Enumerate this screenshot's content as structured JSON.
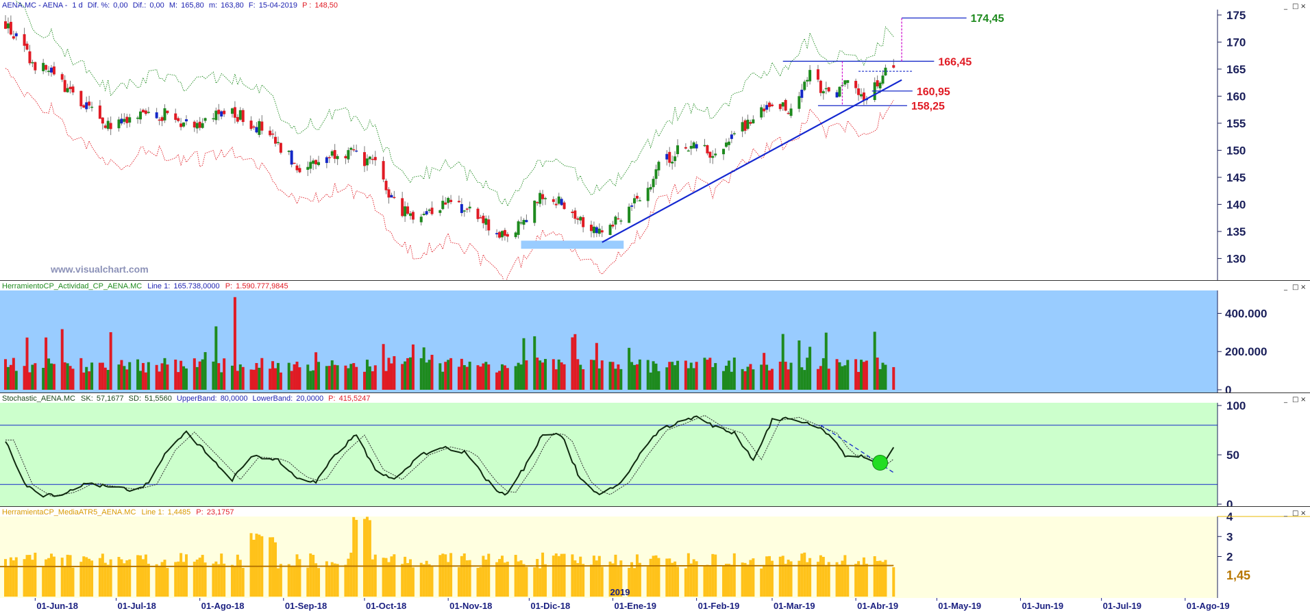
{
  "header": {
    "symbol": "AENA.MC - AENA -",
    "period": "1 d",
    "dif_pct_label": "Dif. %:",
    "dif_pct": "0,00",
    "dif_label": "Dif.:",
    "dif": "0,00",
    "max_label": "M:",
    "max": "165,80",
    "min_label": "m:",
    "min": "163,80",
    "date_label": "F:",
    "date": "15-04-2019",
    "price_label": "P :",
    "price": "148,50"
  },
  "watermark": "www.visualchart.com",
  "colors": {
    "bull": "#1e8a1e",
    "bear": "#e01b24",
    "blue_candle": "#1428c8",
    "upper_band": "#1e8a1e",
    "lower_band": "#e01b24",
    "trendline": "#1428d0",
    "volume_bg": "#99ccff",
    "stoch_bg": "#ccffcc",
    "atr_bg": "#ffffe0",
    "atr_bar": "#ffc21a",
    "atr_avg": "#b87700"
  },
  "window_buttons": [
    "_",
    "□",
    "×"
  ],
  "chart_data": [
    {
      "type": "candlestick",
      "title": "AENA.MC - AENA - 1 d",
      "x_ticks": [
        "01-Jun-18",
        "01-Jul-18",
        "01-Ago-18",
        "01-Sep-18",
        "01-Oct-18",
        "01-Nov-18",
        "01-Dic-18",
        "01-Ene-19",
        "01-Feb-19",
        "01-Mar-19",
        "01-Abr-19",
        "01-May-19",
        "01-Jun-19",
        "01-Jul-19",
        "01-Ago-19"
      ],
      "year_marker": "2019",
      "ylim": [
        126,
        176
      ],
      "y_ticks": [
        130,
        135,
        140,
        145,
        150,
        155,
        160,
        165,
        170,
        175
      ],
      "close_path": [
        [
          "2018-05-21",
          173.5
        ],
        [
          "2018-05-31",
          166
        ],
        [
          "2018-06-08",
          164
        ],
        [
          "2018-06-15",
          160
        ],
        [
          "2018-06-22",
          157
        ],
        [
          "2018-06-29",
          154.5
        ],
        [
          "2018-07-06",
          155
        ],
        [
          "2018-07-13",
          157
        ],
        [
          "2018-07-20",
          156.5
        ],
        [
          "2018-07-27",
          155
        ],
        [
          "2018-08-03",
          155.5
        ],
        [
          "2018-08-10",
          157
        ],
        [
          "2018-08-17",
          156
        ],
        [
          "2018-08-24",
          154
        ],
        [
          "2018-08-31",
          150
        ],
        [
          "2018-09-07",
          147
        ],
        [
          "2018-09-14",
          148
        ],
        [
          "2018-09-21",
          150
        ],
        [
          "2018-09-28",
          149
        ],
        [
          "2018-10-05",
          147
        ],
        [
          "2018-10-12",
          140
        ],
        [
          "2018-10-19",
          138
        ],
        [
          "2018-10-26",
          139
        ],
        [
          "2018-11-02",
          141
        ],
        [
          "2018-11-09",
          138.5
        ],
        [
          "2018-11-16",
          136
        ],
        [
          "2018-11-23",
          133
        ],
        [
          "2018-11-30",
          138
        ],
        [
          "2018-12-07",
          142
        ],
        [
          "2018-12-14",
          140
        ],
        [
          "2018-12-21",
          137
        ],
        [
          "2018-12-28",
          135
        ],
        [
          "2019-01-04",
          138
        ],
        [
          "2019-01-11",
          141
        ],
        [
          "2019-01-18",
          147
        ],
        [
          "2019-01-25",
          150
        ],
        [
          "2019-02-01",
          151
        ],
        [
          "2019-02-08",
          149
        ],
        [
          "2019-02-15",
          153
        ],
        [
          "2019-02-22",
          156
        ],
        [
          "2019-03-01",
          158
        ],
        [
          "2019-03-08",
          158
        ],
        [
          "2019-03-15",
          164
        ],
        [
          "2019-03-22",
          160
        ],
        [
          "2019-03-29",
          162
        ],
        [
          "2019-04-05",
          159.5
        ],
        [
          "2019-04-12",
          164.5
        ],
        [
          "2019-04-15",
          165
        ]
      ],
      "series": [
        {
          "name": "Upper band",
          "offset_above_close": 7
        },
        {
          "name": "Lower band",
          "offset_below_close": 7
        }
      ],
      "trendline": {
        "from": [
          "2018-12-28",
          133
        ],
        "to": [
          "2019-04-18",
          163
        ]
      },
      "support_zone": {
        "from": "2018-11-28",
        "to": "2019-01-05",
        "y_low": 131.8,
        "y_high": 133.3
      },
      "levels": [
        {
          "value": 174.45,
          "label": "174,45",
          "color": "#1e8a1e",
          "from": "2019-04-18",
          "to": "2019-05-12"
        },
        {
          "value": 166.45,
          "label": "166,45",
          "color": "#e01b24",
          "from": "2019-03-05",
          "to": "2019-04-30"
        },
        {
          "value": 160.95,
          "label": "160,95",
          "color": "#e01b24",
          "from": "2019-04-07",
          "to": "2019-04-22"
        },
        {
          "value": 158.25,
          "label": "158,25",
          "color": "#e01b24",
          "from": "2019-03-18",
          "to": "2019-04-20"
        }
      ],
      "target_projection": {
        "x": "2019-04-18",
        "from": 166.45,
        "to": 174.45
      }
    },
    {
      "type": "bar",
      "title": "HerramientoCP_Actividad_CP_AENA.MC",
      "line_label": "Line 1:",
      "line_value": "165.738,0000",
      "p_label": "P:",
      "p_value": "1.590.777,9845",
      "ylim": [
        0,
        520000
      ],
      "y_ticks": [
        {
          "value": 0,
          "label": "0"
        },
        {
          "value": 200000,
          "label": "200.000"
        },
        {
          "value": 400000,
          "label": "400.000"
        }
      ],
      "values_note": "daily volume, green on up days, red on down days"
    },
    {
      "type": "line",
      "title": "Stochastic_AENA.MC",
      "sk_label": "SK:",
      "sk": "57,1677",
      "sd_label": "SD:",
      "sd": "51,5560",
      "upper_label": "UpperBand:",
      "upper": "80,0000",
      "lower_label": "LowerBand:",
      "lower": "20,0000",
      "p_label": "P:",
      "p_value": "415,5247",
      "ylim": [
        0,
        100
      ],
      "y_ticks": [
        {
          "value": 0,
          "label": "0"
        },
        {
          "value": 50,
          "label": "50"
        },
        {
          "value": 100,
          "label": "100"
        }
      ],
      "bands": [
        80,
        20
      ],
      "sk_path": [
        [
          "2018-05-21",
          65
        ],
        [
          "2018-05-28",
          20
        ],
        [
          "2018-06-04",
          8
        ],
        [
          "2018-06-13",
          12
        ],
        [
          "2018-06-20",
          22
        ],
        [
          "2018-06-27",
          18
        ],
        [
          "2018-07-06",
          15
        ],
        [
          "2018-07-13",
          20
        ],
        [
          "2018-07-20",
          55
        ],
        [
          "2018-07-27",
          73
        ],
        [
          "2018-08-06",
          45
        ],
        [
          "2018-08-13",
          25
        ],
        [
          "2018-08-20",
          48
        ],
        [
          "2018-08-30",
          45
        ],
        [
          "2018-09-06",
          28
        ],
        [
          "2018-09-13",
          22
        ],
        [
          "2018-09-20",
          50
        ],
        [
          "2018-09-28",
          70
        ],
        [
          "2018-10-05",
          35
        ],
        [
          "2018-10-12",
          25
        ],
        [
          "2018-10-22",
          50
        ],
        [
          "2018-10-30",
          58
        ],
        [
          "2018-11-08",
          52
        ],
        [
          "2018-11-15",
          25
        ],
        [
          "2018-11-22",
          8
        ],
        [
          "2018-11-30",
          40
        ],
        [
          "2018-12-06",
          72
        ],
        [
          "2018-12-13",
          70
        ],
        [
          "2018-12-20",
          25
        ],
        [
          "2018-12-27",
          8
        ],
        [
          "2019-01-04",
          22
        ],
        [
          "2019-01-11",
          50
        ],
        [
          "2019-01-18",
          75
        ],
        [
          "2019-01-25",
          82
        ],
        [
          "2019-02-01",
          90
        ],
        [
          "2019-02-08",
          78
        ],
        [
          "2019-02-15",
          72
        ],
        [
          "2019-02-22",
          45
        ],
        [
          "2019-03-01",
          85
        ],
        [
          "2019-03-08",
          88
        ],
        [
          "2019-03-15",
          80
        ],
        [
          "2019-03-22",
          72
        ],
        [
          "2019-03-28",
          50
        ],
        [
          "2019-04-03",
          48
        ],
        [
          "2019-04-10",
          38
        ],
        [
          "2019-04-15",
          57
        ]
      ],
      "trendline": {
        "from": [
          "2019-03-19",
          80
        ],
        "to": [
          "2019-04-15",
          32
        ]
      },
      "marker": {
        "date": "2019-04-10",
        "value": 42
      }
    },
    {
      "type": "bar",
      "title": "HerramientaCP_MediaATR5_AENA.MC",
      "line_label": "Line 1:",
      "line_value": "1,4485",
      "p_label": "P:",
      "p_value": "23,1757",
      "ylim": [
        0,
        4
      ],
      "y_ticks": [
        {
          "value": 2,
          "label": "2"
        },
        {
          "value": 3,
          "label": "3"
        },
        {
          "value": 4,
          "label": "4"
        }
      ],
      "last_value_label": "1,45",
      "average_level": 1.5
    }
  ]
}
